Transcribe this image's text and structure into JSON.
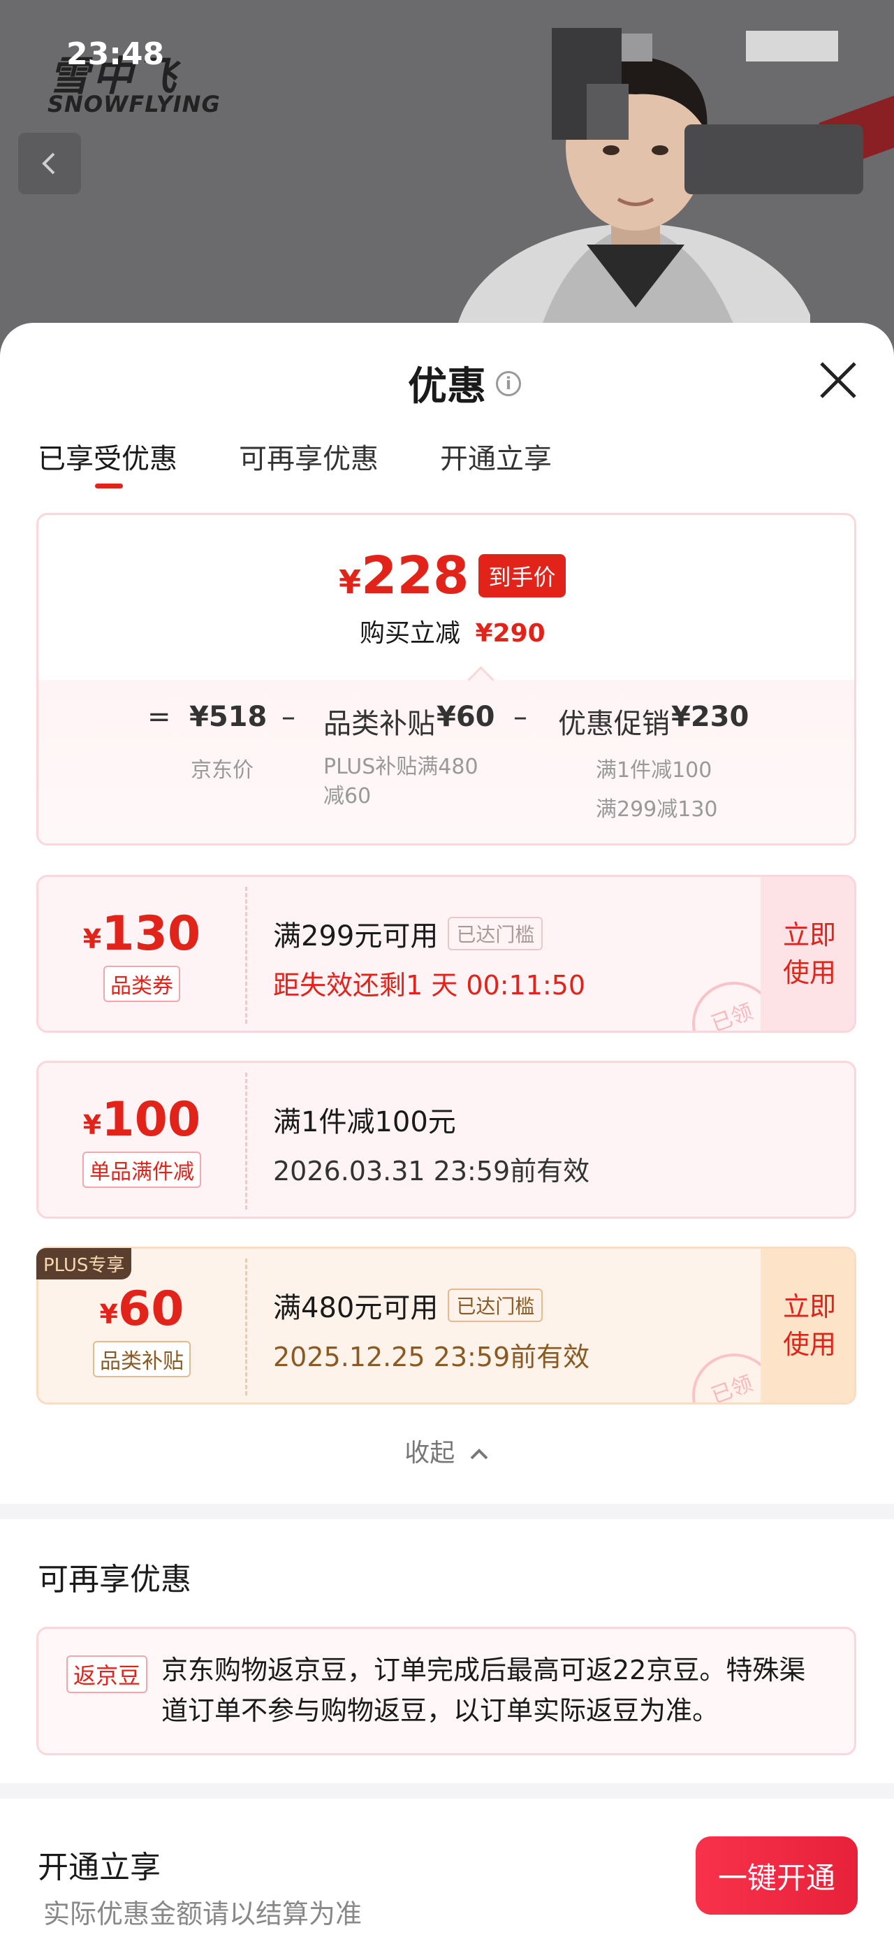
{
  "status_bar": {
    "time": "23:48"
  },
  "product_bg": {
    "brand_cn": "雪中飞",
    "brand_en": "SNOWFLYING"
  },
  "sheet": {
    "title": "优惠",
    "tabs": [
      {
        "label": "已享受优惠",
        "active": true
      },
      {
        "label": "可再享优惠",
        "active": false
      },
      {
        "label": "开通立享",
        "active": false
      }
    ]
  },
  "summary": {
    "yen": "¥",
    "final_price": "228",
    "final_tag": "到手价",
    "reduce_label": "购买立减",
    "reduce_value": "¥290",
    "eq": "=",
    "minus": "–",
    "jd_price": "¥518",
    "jd_price_label": "京东价",
    "subsidy_label": "品类补贴",
    "subsidy_value": "¥60",
    "subsidy_note": "PLUS补贴满480减60",
    "promo_label": "优惠促销",
    "promo_value": "¥230",
    "promo_note1": "满1件减100",
    "promo_note2": "满299减130"
  },
  "coupons": [
    {
      "yen": "¥",
      "amount": "130",
      "tag": "品类券",
      "line1": "满299元可用",
      "reach": "已达门槛",
      "line2": "距失效还剩1 天 00:11:50",
      "btn": "立即使用",
      "stamp": "已领"
    },
    {
      "yen": "¥",
      "amount": "100",
      "tag": "单品满件减",
      "line1": "满1件减100元",
      "line2": "2026.03.31 23:59前有效"
    },
    {
      "badge": "PLUS专享",
      "yen": "¥",
      "amount": "60",
      "tag": "品类补贴",
      "line1": "满480元可用",
      "reach": "已达门槛",
      "line2": "2025.12.25 23:59前有效",
      "btn": "立即使用",
      "stamp": "已领"
    }
  ],
  "collapse_label": "收起",
  "more_section": {
    "title": "可再享优惠",
    "tag": "返京豆",
    "text": "京东购物返京豆，订单完成后最高可返22京豆。特殊渠道订单不参与购物返豆，以订单实际返豆为准。"
  },
  "open_section": {
    "title": "开通立享",
    "sub": "实际优惠金额请以结算为准",
    "button": "一键开通"
  }
}
